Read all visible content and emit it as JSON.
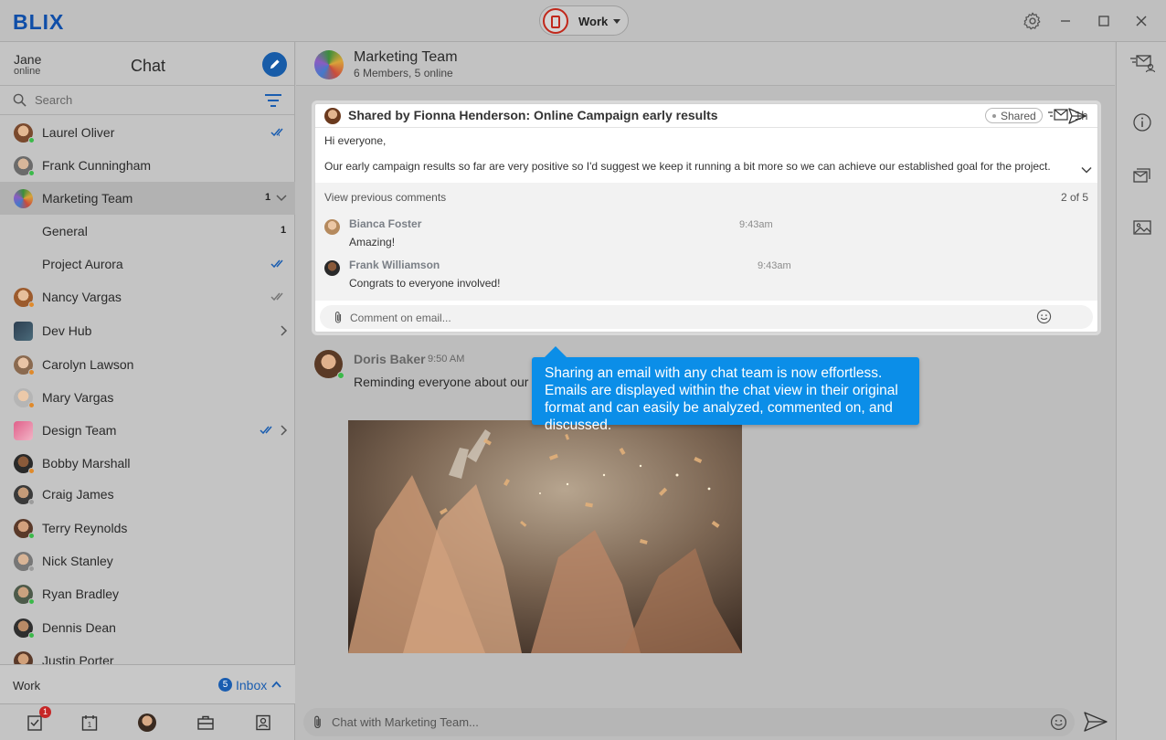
{
  "app": {
    "logo": "BLIX",
    "account_label": "Work",
    "icons": [
      "settings-icon",
      "minimize-icon",
      "maximize-icon",
      "close-icon"
    ]
  },
  "sidebar": {
    "user_name": "Jane",
    "user_status": "online",
    "title": "Chat",
    "search_placeholder": "Search",
    "contacts": [
      {
        "name": "Laurel Oliver",
        "status": "online",
        "read": "double-check-blue"
      },
      {
        "name": "Frank Cunningham",
        "status": "online"
      },
      {
        "name": "Marketing Team",
        "badge": "1",
        "expanded": true
      },
      {
        "name": "General",
        "badge": "1"
      },
      {
        "name": "Project Aurora",
        "read": "double-check-blue"
      },
      {
        "name": "Nancy Vargas",
        "status": "away",
        "read": "double-check-gray"
      },
      {
        "name": "Dev Hub",
        "has_children": true
      },
      {
        "name": "Carolyn Lawson",
        "status": "away"
      },
      {
        "name": "Mary Vargas",
        "status": "away"
      },
      {
        "name": "Design Team",
        "read": "double-check-blue",
        "has_children": true
      },
      {
        "name": "Bobby Marshall",
        "status": "away"
      },
      {
        "name": "Craig James",
        "status": "offline"
      },
      {
        "name": "Terry Reynolds",
        "status": "online"
      },
      {
        "name": "Nick Stanley",
        "status": "offline"
      },
      {
        "name": "Ryan Bradley",
        "status": "online"
      },
      {
        "name": "Dennis Dean",
        "status": "online"
      },
      {
        "name": "Justin Porter"
      }
    ],
    "footer": {
      "account": "Work",
      "inbox_count": "5",
      "inbox_label": "Inbox"
    },
    "bottom_nav": {
      "tasks_badge": "1",
      "calendar_day": "1"
    }
  },
  "chat": {
    "team_name": "Marketing Team",
    "team_sub": "6 Members, 5 online",
    "shared_email": {
      "title": "Shared by Fionna Henderson: Online Campaign early results",
      "status": "Shared",
      "age": "1h",
      "greeting": "Hi everyone,",
      "body": "Our early campaign results so far are very positive so I'd suggest we keep it running a bit more so we can achieve our established goal for the project.",
      "view_previous": "View previous comments",
      "comment_count": "2 of 5",
      "comments": [
        {
          "author": "Bianca Foster",
          "time": "9:43am",
          "text": "Amazing!"
        },
        {
          "author": "Frank Williamson",
          "time": "9:43am",
          "text": "Congrats to everyone involved!"
        }
      ],
      "comment_placeholder": "Comment on email..."
    },
    "message": {
      "author": "Doris Baker",
      "time": "9:50 AM",
      "text": "Reminding everyone about our te"
    },
    "tooltip": "Sharing an email with any chat team is now effortless. Emails are displayed within the chat view in their original format and can easily be analyzed, commented on, and discussed.",
    "composer_placeholder": "Chat with Marketing Team..."
  },
  "colors": {
    "accent": "#1a5db0",
    "tooltip": "#0b8ee8",
    "online": "#3bb94a",
    "away": "#e08a2b",
    "badge_red": "#c62626"
  }
}
